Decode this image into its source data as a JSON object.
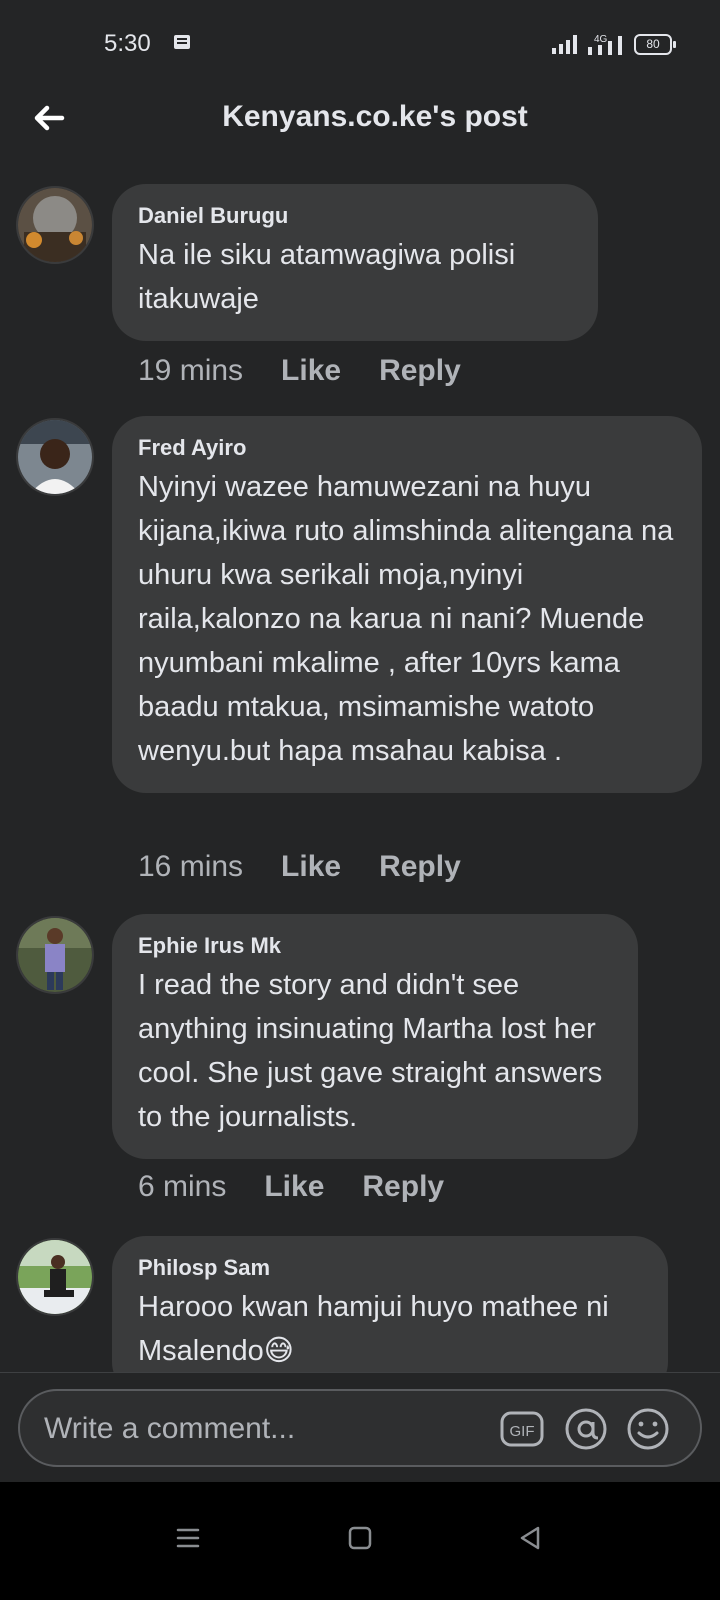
{
  "status_bar": {
    "time": "5:30",
    "network": "4G",
    "battery": "80"
  },
  "header": {
    "title": "Kenyans.co.ke's post"
  },
  "comments": [
    {
      "author": "Daniel Burugu",
      "text": "Na ile siku atamwagiwa polisi itakuwaje",
      "time": "19 mins",
      "like": "Like",
      "reply": "Reply"
    },
    {
      "author": "Fred Ayiro",
      "text": "Nyinyi wazee hamuwezani na huyu kijana,ikiwa ruto alimshinda alitengana na uhuru kwa serikali moja,nyinyi raila,kalonzo na karua ni nani? Muende nyumbani mkalime , after 10yrs kama baadu mtakua, msimamishe watoto wenyu.but hapa msahau kabisa .",
      "time": "16 mins",
      "like": "Like",
      "reply": "Reply"
    },
    {
      "author": "Ephie Irus Mk",
      "text": "I read the story and didn't see anything insinuating Martha lost her cool. She just gave straight answers to the journalists.",
      "time": "6 mins",
      "like": "Like",
      "reply": "Reply"
    },
    {
      "author": "Philosp Sam",
      "text": "Harooo kwan hamjui huyo mathee ni Msalendo😅"
    }
  ],
  "composer": {
    "placeholder": "Write a comment...",
    "gif_label": "GIF"
  },
  "icons": {
    "back": "back-arrow-icon",
    "gif": "gif-icon",
    "mention": "at-icon",
    "emoji": "emoji-icon"
  },
  "colors": {
    "background": "#242526",
    "bubble": "#3a3b3c",
    "text": "#e4e6eb",
    "muted": "#b0b3b8"
  }
}
